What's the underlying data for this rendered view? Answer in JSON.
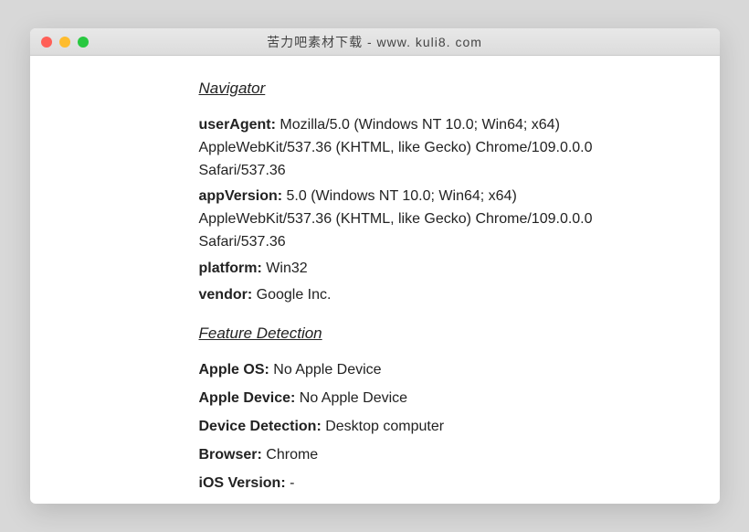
{
  "titlebar": {
    "title": "苦力吧素材下载 - www. kuli8. com"
  },
  "sections": {
    "navigator": {
      "heading": "Navigator",
      "rows": {
        "userAgent": {
          "label": "userAgent:",
          "value": "Mozilla/5.0 (Windows NT 10.0; Win64; x64) AppleWebKit/537.36 (KHTML, like Gecko) Chrome/109.0.0.0 Safari/537.36"
        },
        "appVersion": {
          "label": "appVersion:",
          "value": "5.0 (Windows NT 10.0; Win64; x64) AppleWebKit/537.36 (KHTML, like Gecko) Chrome/109.0.0.0 Safari/537.36"
        },
        "platform": {
          "label": "platform:",
          "value": "Win32"
        },
        "vendor": {
          "label": "vendor:",
          "value": "Google Inc."
        }
      }
    },
    "feature": {
      "heading": "Feature Detection",
      "rows": {
        "appleOS": {
          "label": "Apple OS:",
          "value": "No Apple Device"
        },
        "appleDevice": {
          "label": "Apple Device:",
          "value": "No Apple Device"
        },
        "deviceDetection": {
          "label": "Device Detection:",
          "value": "Desktop computer"
        },
        "browser": {
          "label": "Browser:",
          "value": "Chrome"
        },
        "iosVersion": {
          "label": "iOS Version:",
          "value": "-"
        }
      }
    }
  }
}
